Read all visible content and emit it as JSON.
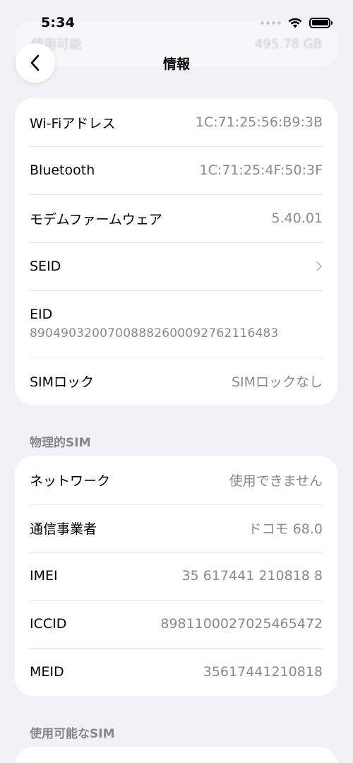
{
  "status_bar": {
    "time": "5:34"
  },
  "ghost_row": {
    "label": "使用可能",
    "value": "495.78 GB"
  },
  "nav": {
    "title": "情報"
  },
  "group1": {
    "rows": [
      {
        "label": "Wi-Fiアドレス",
        "value": "1C:71:25:56:B9:3B"
      },
      {
        "label": "Bluetooth",
        "value": "1C:71:25:4F:50:3F"
      },
      {
        "label": "モデムファームウェア",
        "value": "5.40.01"
      },
      {
        "label": "SEID"
      },
      {
        "label": "EID",
        "value": "89049032007008882600092762116483"
      },
      {
        "label": "SIMロック",
        "value": "SIMロックなし"
      }
    ]
  },
  "section_physical_sim": "物理的SIM",
  "group2": {
    "rows": [
      {
        "label": "ネットワーク",
        "value": "使用できません"
      },
      {
        "label": "通信事業者",
        "value": "ドコモ 68.0"
      },
      {
        "label": "IMEI",
        "value": "35 617441 210818 8"
      },
      {
        "label": "ICCID",
        "value": "8981100027025465472"
      },
      {
        "label": "MEID",
        "value": "35617441210818"
      }
    ]
  },
  "section_available_sim": "使用可能なSIM",
  "colors": {
    "background": "#f2f1f6",
    "card": "#ffffff",
    "secondary_text": "#8a8a8e"
  }
}
